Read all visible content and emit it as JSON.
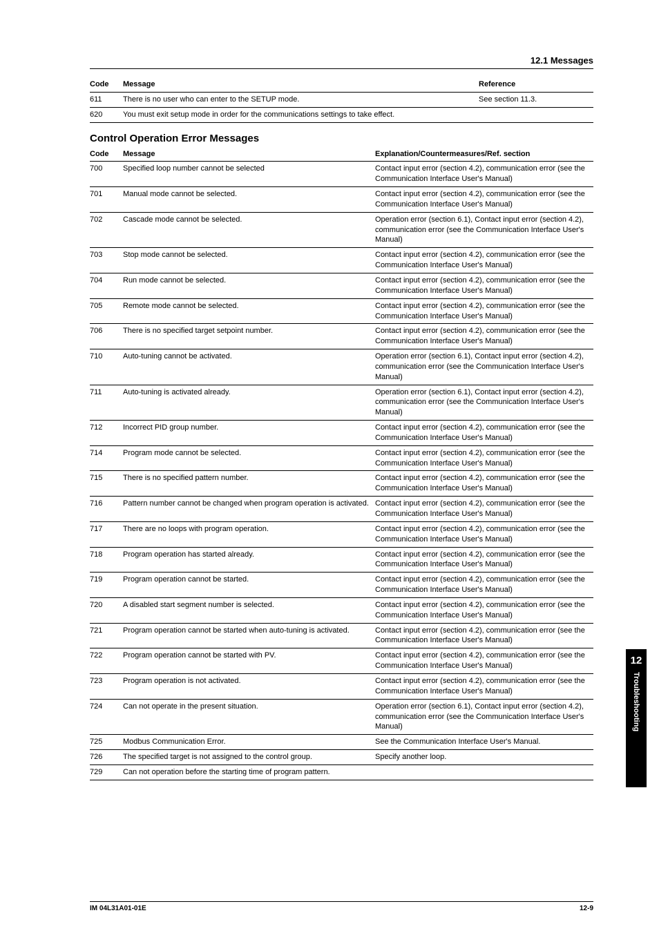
{
  "header": {
    "section": "12.1  Messages"
  },
  "table1": {
    "head": {
      "code": "Code",
      "msg": "Message",
      "ref": "Reference"
    },
    "rows": [
      {
        "code": "611",
        "msg": "There is no user who can enter to the SETUP mode.",
        "ref": "See section 11.3."
      },
      {
        "code": "620",
        "msg": "You must exit setup mode in order for the communications settings to take effect.",
        "ref": ""
      }
    ]
  },
  "section2_title": "Control Operation Error Messages",
  "table2": {
    "head": {
      "code": "Code",
      "msg": "Message",
      "exp": "Explanation/Countermeasures/Ref. section"
    },
    "rows": [
      {
        "code": "700",
        "msg": "Specified loop number cannot be selected",
        "exp": "Contact input error (section 4.2), communication error (see the Communication Interface User's Manual)"
      },
      {
        "code": "701",
        "msg": "Manual mode cannot be selected.",
        "exp": "Contact input error (section 4.2), communication error (see the Communication Interface User's Manual)"
      },
      {
        "code": "702",
        "msg": "Cascade mode cannot be selected.",
        "exp": "Operation error (section 6.1), Contact input error (section 4.2), communication error (see the Communication Interface User's Manual)"
      },
      {
        "code": "703",
        "msg": "Stop mode cannot be selected.",
        "exp": "Contact input error (section 4.2), communication error (see the Communication Interface User's Manual)"
      },
      {
        "code": "704",
        "msg": "Run mode cannot be selected.",
        "exp": "Contact input error (section 4.2), communication error (see the Communication Interface User's Manual)"
      },
      {
        "code": "705",
        "msg": "Remote mode cannot be selected.",
        "exp": "Contact input error (section 4.2), communication error (see the Communication Interface User's Manual)"
      },
      {
        "code": "706",
        "msg": "There is no specified target setpoint number.",
        "exp": "Contact input error (section 4.2), communication error (see the Communication Interface User's Manual)"
      },
      {
        "code": "710",
        "msg": "Auto-tuning cannot be activated.",
        "exp": "Operation error (section 6.1), Contact input error (section 4.2), communication error (see the Communication Interface User's Manual)"
      },
      {
        "code": "711",
        "msg": "Auto-tuning is activated already.",
        "exp": "Operation error (section 6.1), Contact input error (section 4.2), communication error (see the Communication Interface User's Manual)"
      },
      {
        "code": "712",
        "msg": "Incorrect PID group number.",
        "exp": "Contact input error (section 4.2), communication error (see the Communication Interface User's Manual)"
      },
      {
        "code": "714",
        "msg": "Program mode cannot be selected.",
        "exp": "Contact input error (section 4.2), communication error (see the Communication Interface User's Manual)"
      },
      {
        "code": "715",
        "msg": "There is no specified pattern number.",
        "exp": "Contact input error (section 4.2), communication error (see the Communication Interface User's Manual)"
      },
      {
        "code": "716",
        "msg": "Pattern number cannot be changed when program operation is activated.",
        "exp": "Contact input error (section 4.2), communication error (see the Communication Interface User's Manual)"
      },
      {
        "code": "717",
        "msg": "There are no loops with program operation.",
        "exp": "Contact input error (section 4.2), communication error (see the Communication Interface User's Manual)"
      },
      {
        "code": "718",
        "msg": "Program operation has started already.",
        "exp": "Contact input error (section 4.2), communication error (see the Communication Interface User's Manual)"
      },
      {
        "code": "719",
        "msg": "Program operation cannot be started.",
        "exp": "Contact input error (section 4.2), communication error (see the Communication Interface User's Manual)"
      },
      {
        "code": "720",
        "msg": "A disabled start segment number is selected.",
        "exp": "Contact input error (section 4.2), communication error (see the Communication Interface User's Manual)"
      },
      {
        "code": "721",
        "msg": "Program operation cannot be started when auto-tuning is activated.",
        "exp": "Contact input error (section 4.2), communication error (see the Communication Interface User's Manual)"
      },
      {
        "code": "722",
        "msg": "Program operation cannot be started with PV.",
        "exp": "Contact input error (section 4.2), communication error (see the Communication Interface User's Manual)"
      },
      {
        "code": "723",
        "msg": "Program operation is not activated.",
        "exp": "Contact input error (section 4.2), communication error (see the Communication Interface User's Manual)"
      },
      {
        "code": "724",
        "msg": "Can not operate in the present situation.",
        "exp": "Operation error (section 6.1), Contact input error (section 4.2), communication error (see the Communication Interface User's Manual)"
      },
      {
        "code": "725",
        "msg": "Modbus Communication Error.",
        "exp": "See the Communication Interface User's Manual."
      },
      {
        "code": "726",
        "msg": "The specified target is not assigned to the control group.",
        "exp": "Specify another loop."
      },
      {
        "code": "729",
        "msg": "Can not operation before the starting time of program pattern.",
        "exp": ""
      }
    ]
  },
  "sidetab": {
    "num": "12",
    "label": "Troubleshooting"
  },
  "footer": {
    "left": "IM 04L31A01-01E",
    "right": "12-9"
  }
}
